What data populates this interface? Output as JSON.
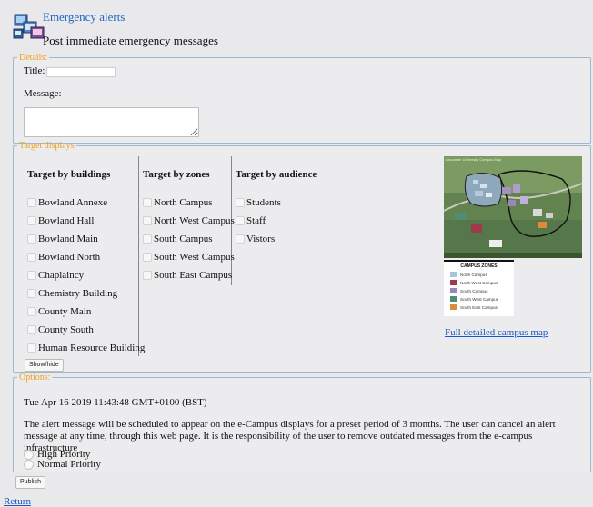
{
  "header": {
    "title": "Emergency alerts",
    "subtitle": "Post immediate emergency messages"
  },
  "details": {
    "legend": "Details:",
    "title_label": "Title:",
    "title_value": "",
    "message_label": "Message:",
    "message_value": ""
  },
  "targets": {
    "legend": "Target displays",
    "buildings_heading": "Target by buildings",
    "zones_heading": "Target by zones",
    "audience_heading": "Target by audience",
    "buildings": [
      "Bowland Annexe",
      "Bowland Hall",
      "Bowland Main",
      "Bowland North",
      "Chaplaincy",
      "Chemistry Building",
      "County Main",
      "County South",
      "Human Resource Building"
    ],
    "zones": [
      "North Campus",
      "North West Campus",
      "South Campus",
      "South West Campus",
      "South East Campus"
    ],
    "audience": [
      "Students",
      "Staff",
      "Vistors"
    ],
    "show_hide_label": "Show/hide",
    "map_caption": "Lancaster University Campus Map",
    "map_legend": {
      "title": "CAMPUS ZONES",
      "items": [
        {
          "label": "North Campus",
          "color": "#a9c4dd"
        },
        {
          "label": "North West Campus",
          "color": "#9c3b4c"
        },
        {
          "label": "South Campus",
          "color": "#9a85bf"
        },
        {
          "label": "South West Campus",
          "color": "#4f8d77"
        },
        {
          "label": "South East Campus",
          "color": "#e08a3b"
        }
      ]
    },
    "full_map_link": "Full detailed campus map"
  },
  "options": {
    "legend": "Options:",
    "timestamp": "Tue Apr 16 2019 11:43:48 GMT+0100 (BST)",
    "notice": "The alert message will be scheduled to appear on the e-Campus displays for a preset period of 3 months. The user can cancel an alert message at any time, through this web page. It is the responsibility of the user to remove outdated messages from the e-campus infrastructure",
    "priorities": [
      "High Priority",
      "Normal Priority"
    ]
  },
  "actions": {
    "publish_label": "Publish",
    "return_link": "Return"
  },
  "colors": {
    "legend_text": "#f0a11a",
    "link": "#1a57c9",
    "title_blue": "#2067c4",
    "fieldset_border": "#9fb7cf"
  }
}
